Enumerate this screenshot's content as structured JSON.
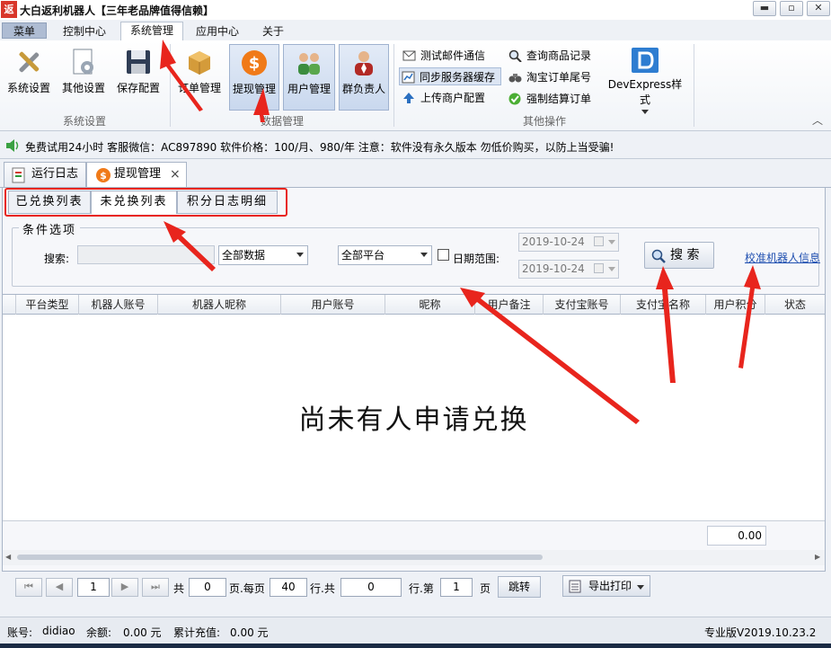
{
  "window": {
    "icon_char": "返",
    "title": "大白返利机器人【三年老品牌值得信赖】",
    "minimize": "▬",
    "maximize": "▫",
    "close": "✕"
  },
  "menu": {
    "tabs": [
      "菜单",
      "控制中心",
      "系统管理",
      "应用中心",
      "关于"
    ]
  },
  "ribbon": {
    "buttons": [
      "系统设置",
      "其他设置",
      "保存配置",
      "订单管理",
      "提现管理",
      "用户管理",
      "群负责人"
    ],
    "groups": [
      "系统设置",
      "数据管理",
      "其他操作"
    ],
    "small_buttons": [
      "测试邮件通信",
      "同步服务器缓存",
      "上传商户配置",
      "查询商品记录",
      "淘宝订单尾号",
      "强制结算订单"
    ],
    "devexpress": "DevExpress样式",
    "collapse_icon": "︿"
  },
  "notice": "免费试用24小时 客服微信：AC897890 软件价格：100/月、980/年 注意：软件没有永久版本 勿低价购买，以防上当受骗!",
  "doc_tabs": [
    "运行日志",
    "提现管理"
  ],
  "doc_tab_close": "×",
  "sub_tabs": [
    "已兑换列表",
    "未兑换列表",
    "积分日志明细"
  ],
  "conditions": {
    "legend": "条件选项",
    "search_label": "搜索:",
    "search_value": "",
    "data_filter": "全部数据",
    "platform_filter": "全部平台",
    "date_range_label": "日期范围:",
    "date_from": "2019-10-24",
    "date_to": "2019-10-24",
    "search_button": "搜 索",
    "calibrate_link": "校准机器人信息"
  },
  "grid": {
    "columns": [
      "平台类型",
      "机器人账号",
      "机器人昵称",
      "用户账号",
      "昵称",
      "用户备注",
      "支付宝账号",
      "支付宝名称",
      "用户积分",
      "状态"
    ],
    "empty_message": "尚未有人申请兑换",
    "sum": "0.00"
  },
  "pager": {
    "first": "⏮",
    "prev": "◀",
    "next": "▶",
    "last": "⏭",
    "page": "1",
    "total_label": "共",
    "total_pages": "0",
    "per_page_label": "页.每页",
    "per_page": "40",
    "rows_label": "行.共",
    "total_rows": "0",
    "goto_label": "行.第",
    "goto_page": "1",
    "page_suffix": "页",
    "jump_button": "跳转",
    "export_button": "导出打印"
  },
  "status": {
    "account_label": "账号:",
    "account": "didiao",
    "balance_label": "余额:",
    "balance": "0.00 元",
    "recharge_label": "累计充值:",
    "recharge": "0.00 元",
    "version": "专业版V2019.10.23.2"
  },
  "colors": {
    "annotation_red": "#e8251d",
    "accent": "#9fb2cf",
    "window_bg": "#eef1f6"
  }
}
